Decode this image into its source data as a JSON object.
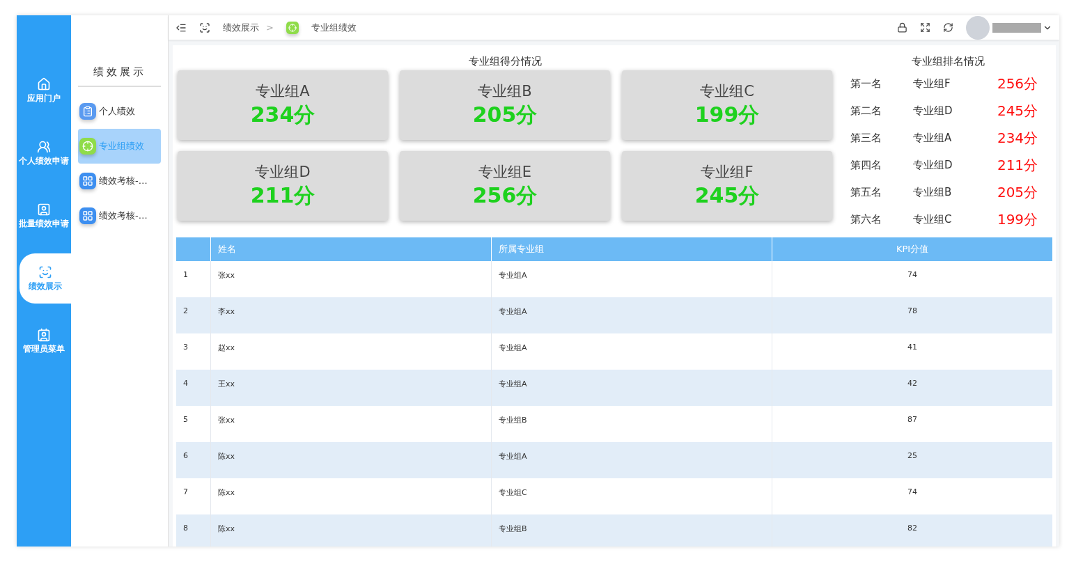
{
  "nav": [
    {
      "label": "应用门户",
      "selected": false
    },
    {
      "label": "个人绩效申请",
      "selected": false
    },
    {
      "label": "批量绩效申请",
      "selected": false
    },
    {
      "label": "绩效展示",
      "selected": true
    },
    {
      "label": "管理员菜单",
      "selected": false
    }
  ],
  "sidebar": {
    "title": "绩效展示",
    "items": [
      {
        "label": "个人绩效",
        "selected": false,
        "kind": "clipboard"
      },
      {
        "label": "专业组绩效",
        "selected": true,
        "kind": "target"
      },
      {
        "label": "绩效考核-…",
        "selected": false,
        "kind": "grid"
      },
      {
        "label": "绩效考核-…",
        "selected": false,
        "kind": "grid"
      }
    ]
  },
  "breadcrumb": [
    "绩效展示",
    ">",
    "专业组绩效"
  ],
  "score_panel": {
    "title": "专业组得分情况",
    "cards": [
      {
        "name": "专业组A",
        "score": "234分"
      },
      {
        "name": "专业组B",
        "score": "205分"
      },
      {
        "name": "专业组C",
        "score": "199分"
      },
      {
        "name": "专业组D",
        "score": "211分"
      },
      {
        "name": "专业组E",
        "score": "256分"
      },
      {
        "name": "专业组F",
        "score": "245分"
      }
    ]
  },
  "ranking": {
    "title": "专业组排名情况",
    "rows": [
      {
        "rank": "第一名",
        "group": "专业组F",
        "score": "256分"
      },
      {
        "rank": "第二名",
        "group": "专业组D",
        "score": "245分"
      },
      {
        "rank": "第三名",
        "group": "专业组A",
        "score": "234分"
      },
      {
        "rank": "第四名",
        "group": "专业组D",
        "score": "211分"
      },
      {
        "rank": "第五名",
        "group": "专业组B",
        "score": "205分"
      },
      {
        "rank": "第六名",
        "group": "专业组C",
        "score": "199分"
      }
    ]
  },
  "table": {
    "columns": [
      "",
      "姓名",
      "所属专业组",
      "KPI分值"
    ],
    "rows": [
      [
        "1",
        "张xx",
        "专业组A",
        "74"
      ],
      [
        "2",
        "李xx",
        "专业组A",
        "78"
      ],
      [
        "3",
        "赵xx",
        "专业组A",
        "41"
      ],
      [
        "4",
        "王xx",
        "专业组A",
        "42"
      ],
      [
        "5",
        "张xx",
        "专业组B",
        "87"
      ],
      [
        "6",
        "陈xx",
        "专业组A",
        "25"
      ],
      [
        "7",
        "陈xx",
        "专业组C",
        "74"
      ],
      [
        "8",
        "陈xx",
        "专业组B",
        "82"
      ]
    ]
  }
}
